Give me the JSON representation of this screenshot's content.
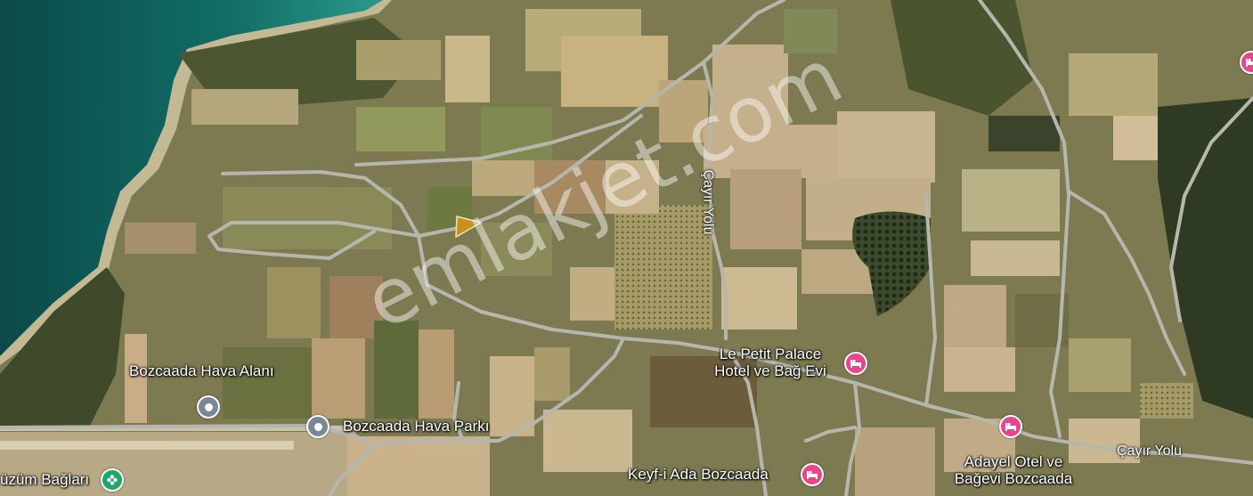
{
  "watermark": "emlakjet.com",
  "roads": {
    "cayir_yolu_vertical": "Çayır Yolu",
    "cayir_yolu_horizontal": "Çayır Yolu"
  },
  "places": [
    {
      "id": "airport",
      "name": "Bozcaada Hava Alanı",
      "icon": "location-pin-icon",
      "color": "#7a8794"
    },
    {
      "id": "air_park",
      "name": "Bozcaada Hava Parkı",
      "icon": "location-pin-icon",
      "color": "#7a8794"
    },
    {
      "id": "le_petit",
      "name_line1": "Le Petit Palace",
      "name_line2": "Hotel ve Bağ Evi",
      "icon": "hotel-bed-icon",
      "color": "#e8458b"
    },
    {
      "id": "keyf",
      "name": "Keyf-i Ada Bozcaada",
      "icon": "hotel-bed-icon",
      "color": "#e8458b"
    },
    {
      "id": "adayel",
      "name_line1": "Adayel Otel ve",
      "name_line2": "Bağevi Bozcaada",
      "icon": "hotel-bed-icon",
      "color": "#e8458b"
    },
    {
      "id": "uzum",
      "name": "üzüm Bağları",
      "icon": "flower-icon",
      "color": "#20a56a"
    }
  ],
  "parcel": {
    "highlight_color": "#c8901e"
  }
}
